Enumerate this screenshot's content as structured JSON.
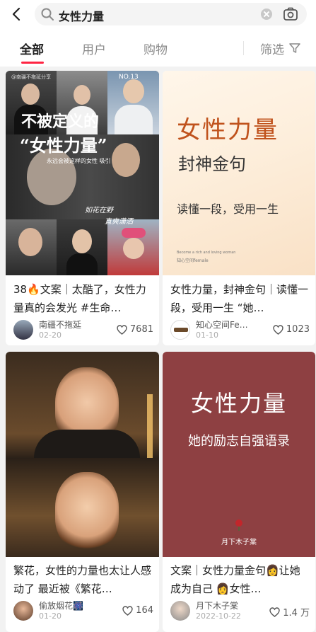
{
  "search": {
    "query": "女性力量"
  },
  "tabs": [
    {
      "label": "全部",
      "active": true
    },
    {
      "label": "用户",
      "active": false
    },
    {
      "label": "购物",
      "active": false
    }
  ],
  "filter_label": "筛选",
  "accent_color": "#ff2442",
  "cards": [
    {
      "title": "38🔥文案｜太酷了，女性力量真的会发光 #生命…",
      "author": "南疆不拖延",
      "date": "02-20",
      "likes": "7681",
      "cover": {
        "top_small": "@南疆不拖延分享",
        "number": "NO.13",
        "line1": "不被定义的",
        "line2": "“女性力量”",
        "sub": "永远会被这样的女性 吸引",
        "script1": "如花在野",
        "script2": "直爽潇洒"
      }
    },
    {
      "title": "女性力量，封神金句｜读懂一段，受用一生 “她…",
      "author": "知心空间Fe…",
      "date": "01-10",
      "likes": "1023",
      "cover": {
        "line1": "女性力量",
        "line2": "封神金句",
        "line3": "读懂一段，受用一生",
        "small1": "Become a rich and loving woman",
        "small2": "知心空间female"
      }
    },
    {
      "title": "繁花，女性的力量也太让人感动了 最近被《繁花…",
      "author": "偷放烟花🎆",
      "date": "01-20",
      "likes": "164",
      "cover": {}
    },
    {
      "title": "文案｜女性力量金句👩让她成为自己 👩女性…",
      "author": "月下木子棠",
      "date": "2022-10-22",
      "likes": "1.4 万",
      "cover": {
        "line1": "女性力量",
        "line2": "她的励志自强语录",
        "sign": "月下木子棠"
      }
    }
  ]
}
